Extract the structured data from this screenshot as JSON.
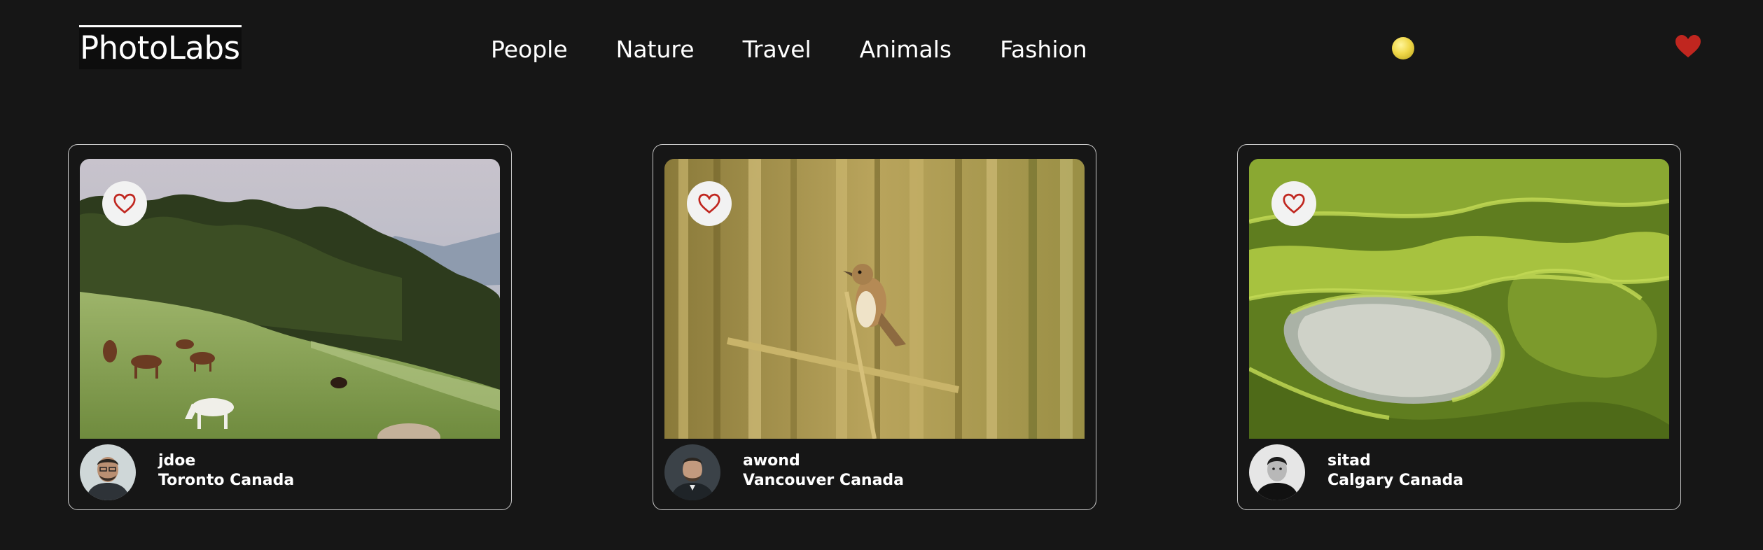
{
  "app": {
    "logo": "PhotoLabs"
  },
  "topics": [
    {
      "label": "People"
    },
    {
      "label": "Nature"
    },
    {
      "label": "Travel"
    },
    {
      "label": "Animals"
    },
    {
      "label": "Fashion"
    }
  ],
  "colors": {
    "background": "#161616",
    "accent_heart": "#c0261f",
    "notification_dot": "#f0d84a",
    "card_border": "#c9c9c9"
  },
  "icons": {
    "nav_favorites": "heart-filled-icon",
    "photo_favorite": "heart-outline-icon"
  },
  "photos": [
    {
      "username": "jdoe",
      "location": "Toronto Canada",
      "scene": "horses grazing on hillside"
    },
    {
      "username": "awond",
      "location": "Vancouver Canada",
      "scene": "bird perched among reeds"
    },
    {
      "username": "sitad",
      "location": "Calgary Canada",
      "scene": "terraced rice fields"
    }
  ]
}
